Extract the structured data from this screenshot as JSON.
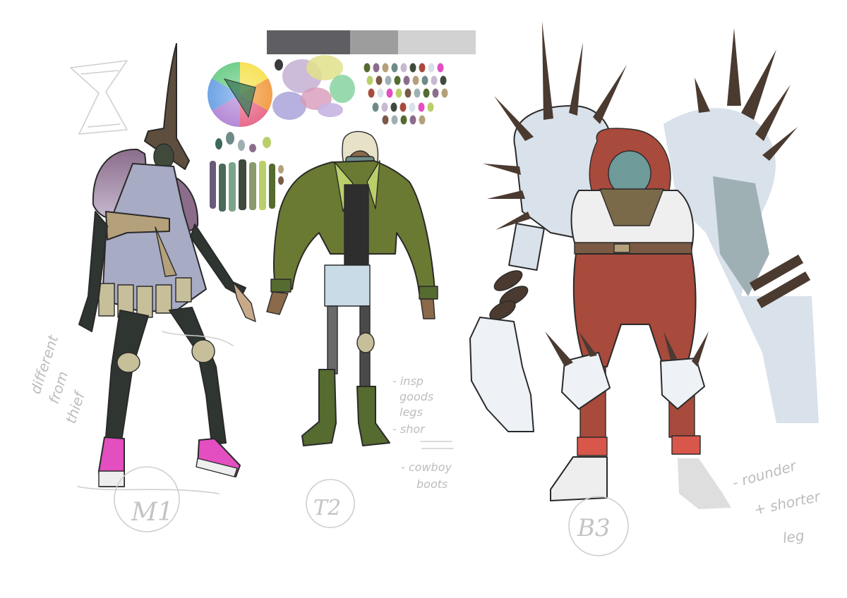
{
  "canvas": {
    "background": "#ffffff"
  },
  "value_scale": [
    "#5f5f63",
    "#9d9d9d",
    "#d2d2d2"
  ],
  "palette": {
    "colors": [
      "#556b2f",
      "#8b6d8b",
      "#b4a07a",
      "#6e8b88",
      "#c7b9d0",
      "#3f4a3d",
      "#a84a3c",
      "#d9e1ea",
      "#e34ec0",
      "#b9cf6a",
      "#7a5a45",
      "#9fb0b4"
    ]
  },
  "characters": [
    {
      "label": "M1",
      "notes": [
        "different",
        "from",
        "thief"
      ]
    },
    {
      "label": "T2",
      "notes": [
        "- insp",
        "goods",
        "legs",
        "- shor",
        "- cowboy",
        "boots"
      ]
    },
    {
      "label": "B3",
      "notes": [
        "- rounder",
        "+ shorter",
        "leg"
      ]
    }
  ]
}
